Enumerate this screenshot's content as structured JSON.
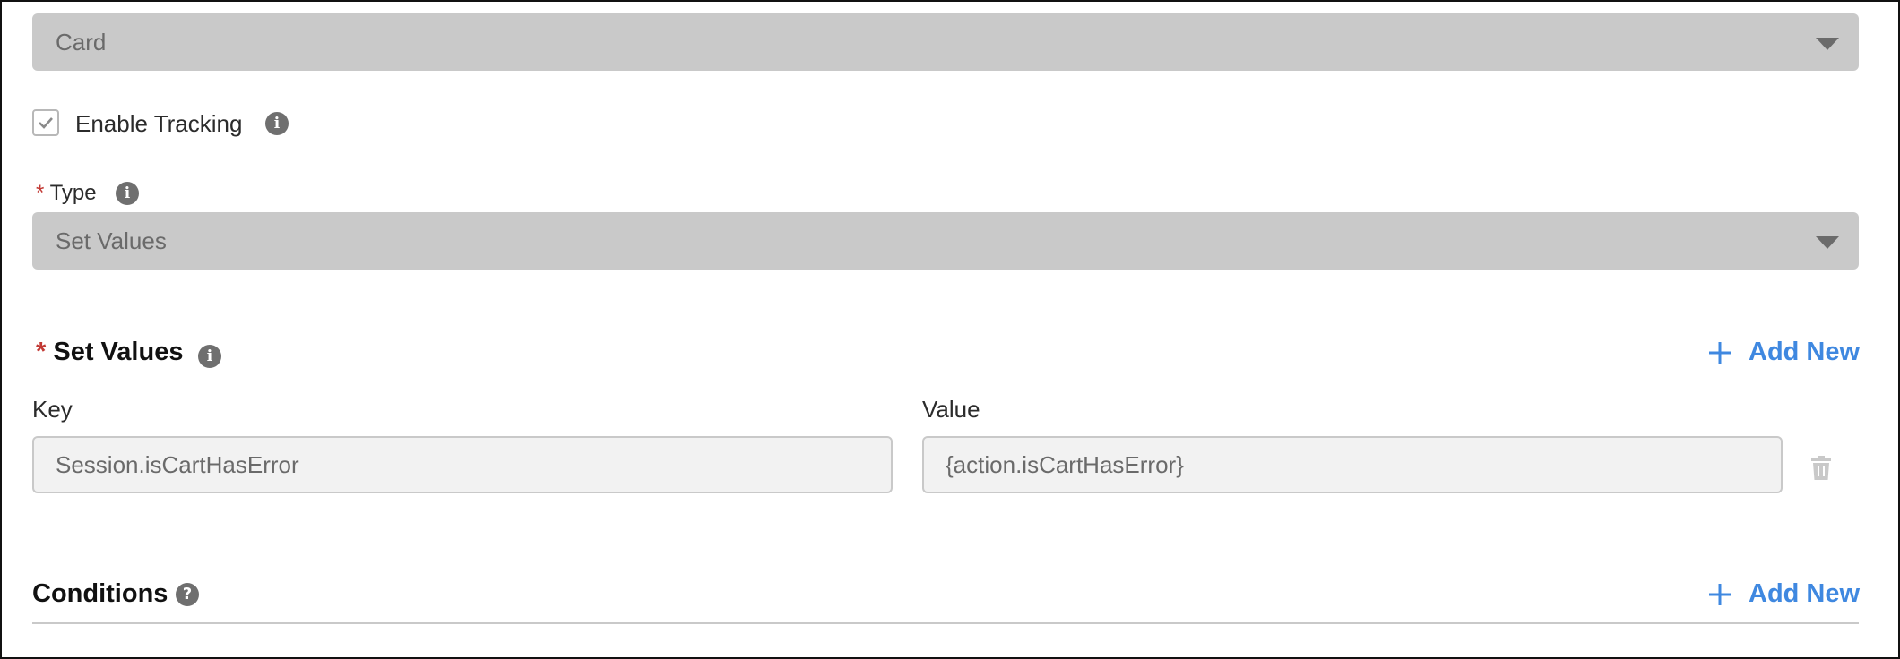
{
  "top_select": {
    "value": "Card"
  },
  "tracking": {
    "label": "Enable Tracking",
    "checked": true
  },
  "type_field": {
    "required_mark": "*",
    "label": "Type",
    "value": "Set Values"
  },
  "set_values": {
    "required_mark": "*",
    "title": "Set Values",
    "add_new_label": "Add New",
    "key_header": "Key",
    "value_header": "Value",
    "rows": [
      {
        "key": "Session.isCartHasError",
        "value": "{action.isCartHasError}"
      }
    ]
  },
  "conditions": {
    "title": "Conditions",
    "add_new_label": "Add New"
  },
  "icons": {
    "info": "info-icon",
    "help": "question-icon",
    "add": "plus-icon",
    "delete": "trash-icon",
    "dropdown": "caret-down-icon",
    "check": "checkmark-icon"
  },
  "colors": {
    "accent": "#3f88e0",
    "required": "#c23934",
    "select_bg": "#c9c9c9",
    "input_bg": "#f2f2f2"
  }
}
